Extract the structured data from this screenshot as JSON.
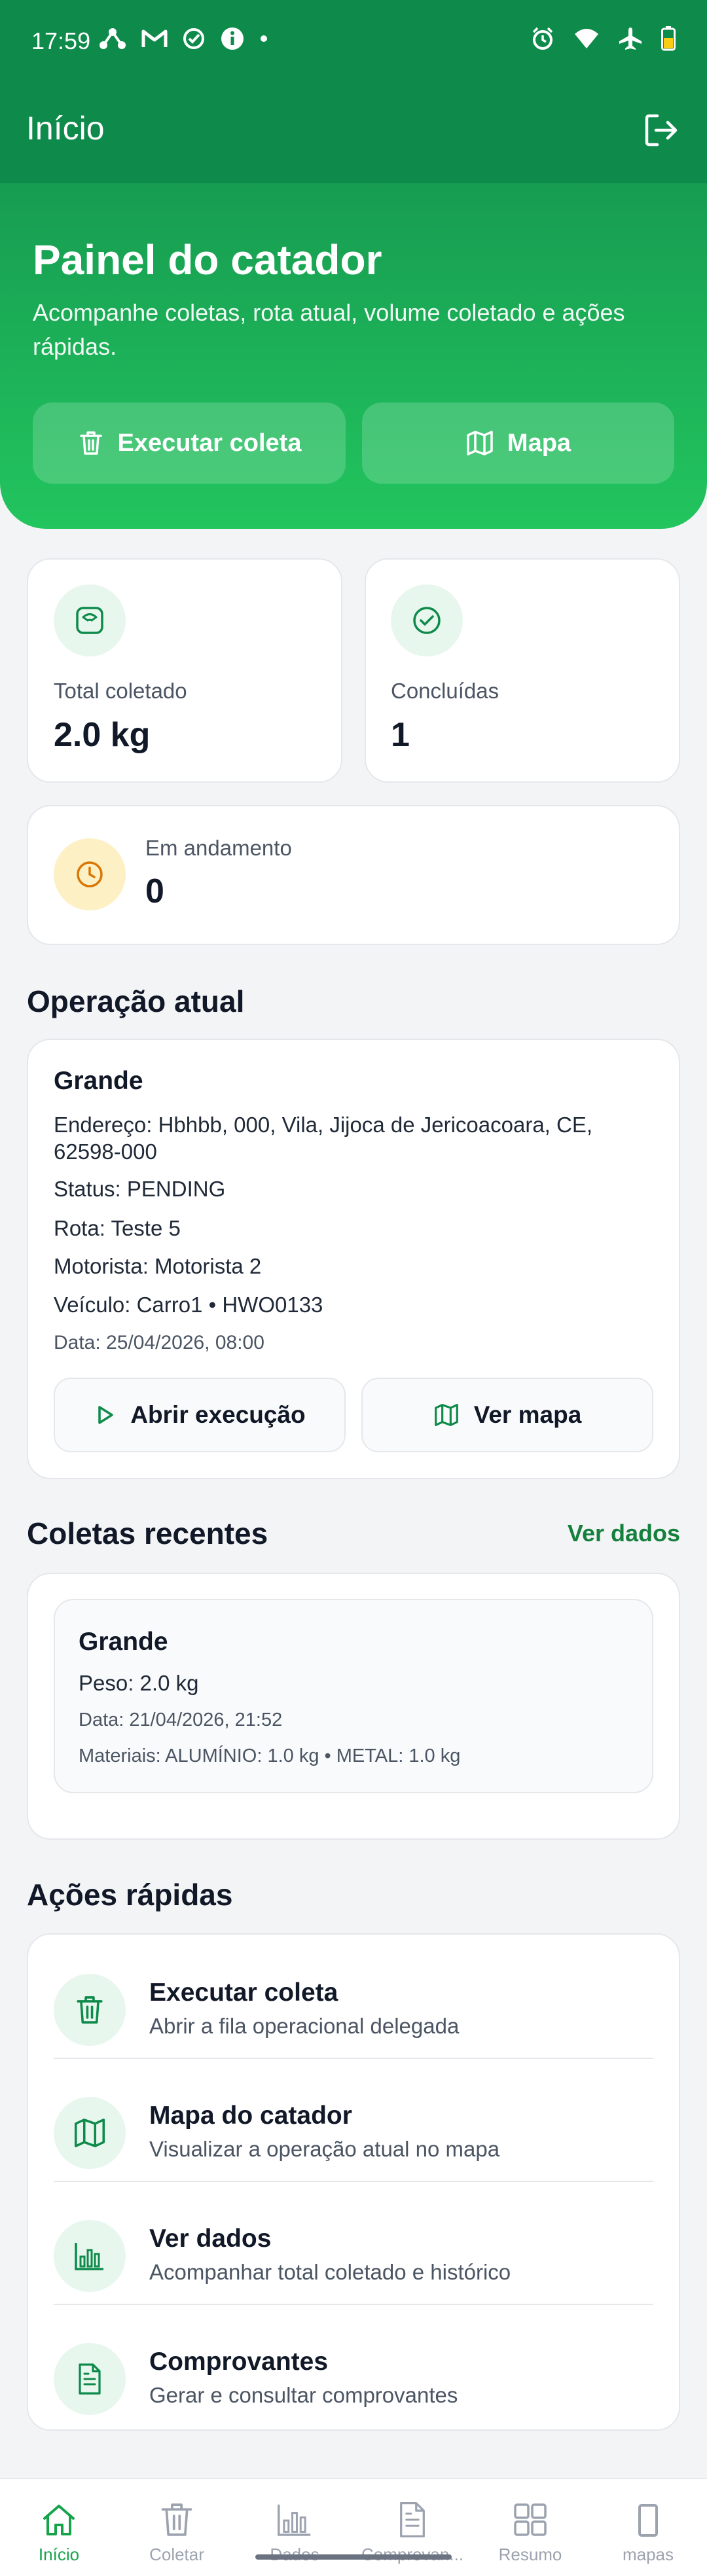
{
  "status_bar": {
    "time": "17:59"
  },
  "app_bar": {
    "title": "Início"
  },
  "hero": {
    "title": "Painel do catador",
    "subtitle": "Acompanhe coletas, rota atual, volume coletado e ações rápidas.",
    "execute_label": "Executar coleta",
    "map_label": "Mapa"
  },
  "stats": {
    "total_label": "Total coletado",
    "total_value": "2.0 kg",
    "done_label": "Concluídas",
    "done_value": "1",
    "progress_label": "Em andamento",
    "progress_value": "0"
  },
  "current_operation": {
    "section_title": "Operação atual",
    "name": "Grande",
    "address_line1": "Endereço: Hbhbb, 000, Vila, Jijoca de Jericoacoara, CE,",
    "address_line2": "62598-000",
    "status": "Status: PENDING",
    "route": "Rota: Teste 5",
    "driver": "Motorista: Motorista 2",
    "vehicle": "Veículo: Carro1 • HWO0133",
    "date": "Data: 25/04/2026, 08:00",
    "open_label": "Abrir execução",
    "map_label": "Ver mapa"
  },
  "recent": {
    "section_title": "Coletas recentes",
    "link_label": "Ver dados",
    "items": [
      {
        "name": "Grande",
        "weight": "Peso: 2.0 kg",
        "date": "Data: 21/04/2026, 21:52",
        "materials": "Materiais: ALUMÍNIO: 1.0 kg • METAL: 1.0 kg"
      }
    ]
  },
  "quick_actions": {
    "section_title": "Ações rápidas",
    "items": [
      {
        "title": "Executar coleta",
        "subtitle": "Abrir a fila operacional delegada",
        "icon": "trash-icon"
      },
      {
        "title": "Mapa do catador",
        "subtitle": "Visualizar a operação atual no mapa",
        "icon": "map-icon"
      },
      {
        "title": "Ver dados",
        "subtitle": "Acompanhar total coletado e histórico",
        "icon": "bar-chart-icon"
      },
      {
        "title": "Comprovantes",
        "subtitle": "Gerar e consultar comprovantes",
        "icon": "document-icon"
      }
    ]
  },
  "bottom_nav": {
    "items": [
      {
        "label": "Início",
        "icon": "home-icon",
        "active": true
      },
      {
        "label": "Coletar",
        "icon": "trash-icon"
      },
      {
        "label": "Dados",
        "icon": "bar-chart-icon"
      },
      {
        "label": "Comprovan...",
        "icon": "document-icon"
      },
      {
        "label": "Resumo",
        "icon": "grid-icon"
      },
      {
        "label": "mapas",
        "icon": "phone-icon"
      }
    ]
  },
  "colors": {
    "primary": "#0e8a4a",
    "accent": "#22c55e",
    "link": "#15803d",
    "warning_bg": "#fdf0c4",
    "warning_icon": "#d97706"
  }
}
